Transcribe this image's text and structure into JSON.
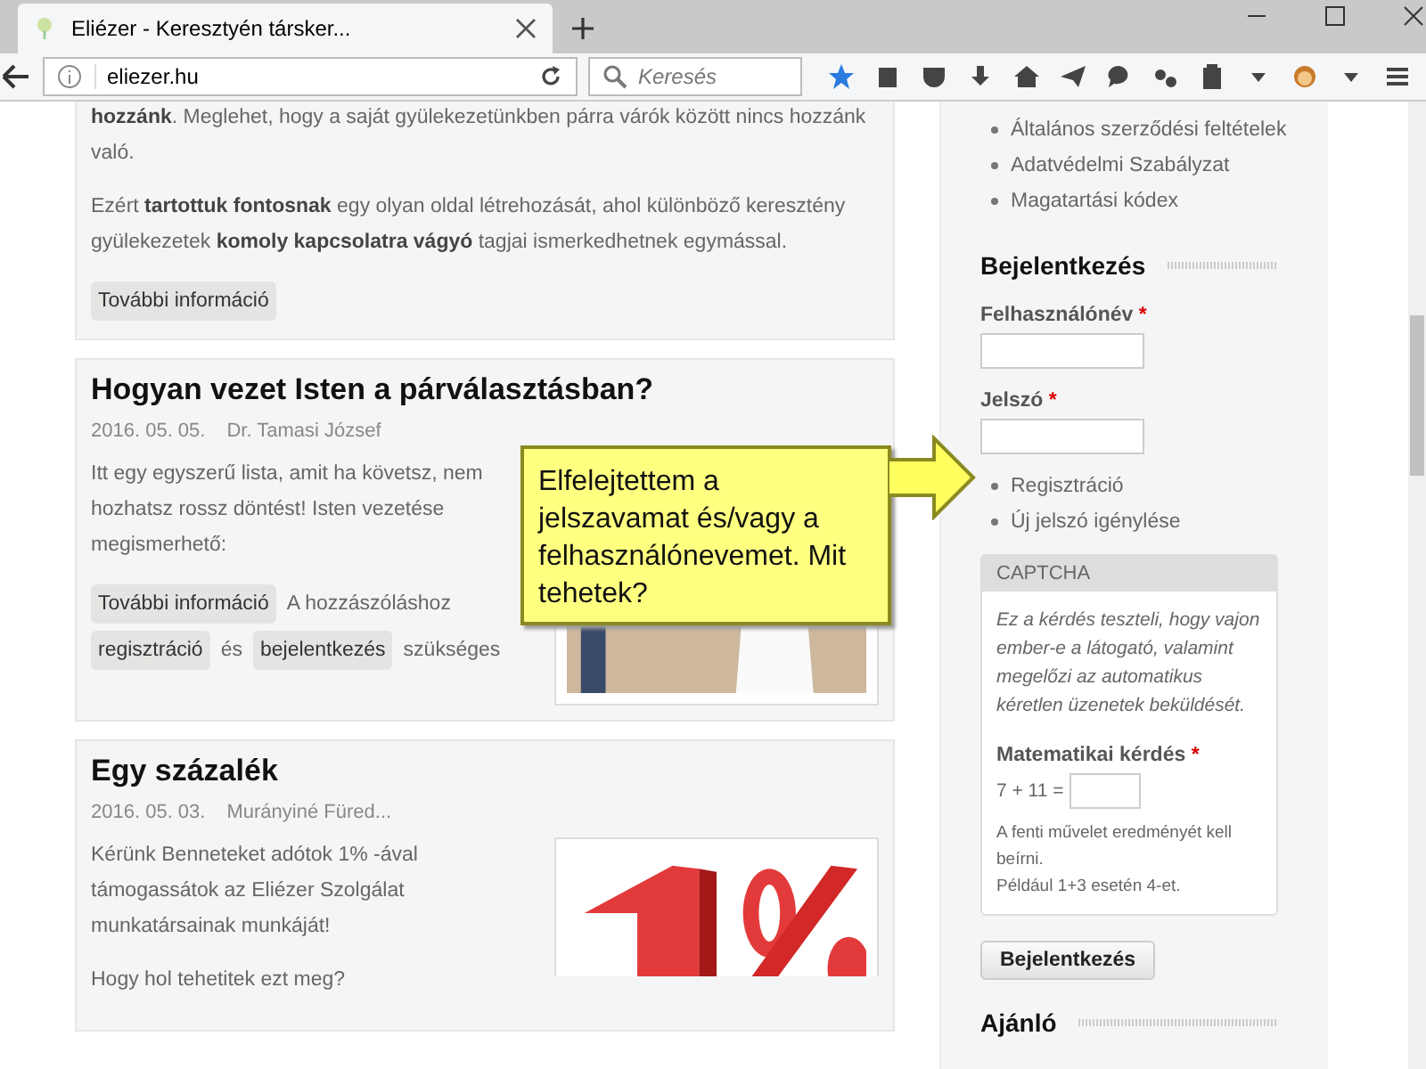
{
  "browser": {
    "tab_title": "Eliézer - Keresztyén társker...",
    "url": "eliezer.hu",
    "search_placeholder": "Keresés"
  },
  "articles": [
    {
      "paragraphs": [
        "**hozzánk**. Meglehet, hogy a saját gyülekezetünkben párra várók között nincs hozzánk való.",
        "Ezért **tartottuk fontosnak** egy olyan oldal létrehozását, ahol különböző keresztény gyülekezetek **komoly kapcsolatra vágyó** tagjai ismerkedhetnek egymással."
      ],
      "footer": [
        {
          "kind": "button",
          "text": "További információ"
        }
      ]
    },
    {
      "title": "Hogyan vezet Isten a párválasztásban?",
      "date": "2016. 05. 05.",
      "author": "Dr. Tamasi József",
      "paragraphs": [
        "Itt egy egyszerű lista, amit ha követsz, nem hozhatsz rossz döntést! Isten vezetése megismerhető:"
      ],
      "footer": [
        {
          "kind": "button",
          "text": "További információ"
        },
        {
          "kind": "text",
          "text": "A hozzászóláshoz"
        },
        {
          "kind": "button",
          "text": "regisztráció"
        },
        {
          "kind": "text",
          "text": "és"
        },
        {
          "kind": "button",
          "text": "bejelentkezés"
        },
        {
          "kind": "text",
          "text": "szükséges"
        }
      ],
      "image": {
        "kind": "picture"
      }
    },
    {
      "title": "Egy százalék",
      "date": "2016. 05. 03.",
      "author": "Murányiné Füred...",
      "paragraphs": [
        "Kérünk Benneteket adótok 1% -ával támogassátok az Eliézer Szolgálat munkatársainak munkáját!",
        "Hogy hol tehetitek ezt meg?"
      ],
      "image": {
        "kind": "picture"
      }
    }
  ],
  "sidebar": {
    "links": [
      "Általános szerződési feltételek",
      "Adatvédelmi Szabályzat",
      "Magatartási kódex"
    ],
    "login": {
      "title": "Bejelentkezés",
      "username_label": "Felhasználónév",
      "password_label": "Jelszó",
      "required_mark": "*",
      "links": [
        "Regisztráció",
        "Új jelszó igénylése"
      ],
      "captcha": {
        "header": "CAPTCHA",
        "description": "Ez a kérdés teszteli, hogy vajon ember-e a látogató, valamint megelőzi az automatikus kéretlen üzenetek beküldését.",
        "question_label": "Matematikai kérdés",
        "equation": "7 + 11 =",
        "hints": [
          "A fenti művelet eredményét kell beírni.",
          "Például 1+3 esetén 4-et."
        ]
      },
      "submit": "Bejelentkezés"
    },
    "next_heading": "Ajánló"
  },
  "callout": {
    "text": "Elfelejtettem a jelszavamat és/vagy a felhasználónevemet. Mit tehetek?"
  }
}
